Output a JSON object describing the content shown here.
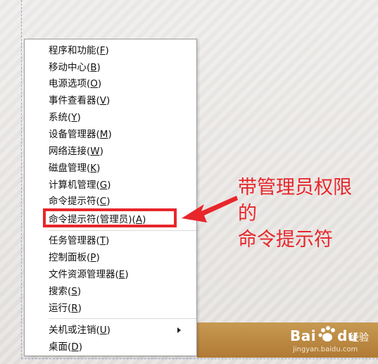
{
  "context_menu": {
    "items": [
      {
        "prefix": "程序和功能(",
        "key": "F",
        "suffix": ")"
      },
      {
        "prefix": "移动中心(",
        "key": "B",
        "suffix": ")"
      },
      {
        "prefix": "电源选项(",
        "key": "O",
        "suffix": ")"
      },
      {
        "prefix": "事件查看器(",
        "key": "V",
        "suffix": ")"
      },
      {
        "prefix": "系统(",
        "key": "Y",
        "suffix": ")"
      },
      {
        "prefix": "设备管理器(",
        "key": "M",
        "suffix": ")"
      },
      {
        "prefix": "网络连接(",
        "key": "W",
        "suffix": ")"
      },
      {
        "prefix": "磁盘管理(",
        "key": "K",
        "suffix": ")"
      },
      {
        "prefix": "计算机管理(",
        "key": "G",
        "suffix": ")"
      },
      {
        "prefix": "命令提示符(",
        "key": "C",
        "suffix": ")"
      },
      {
        "prefix": "命令提示符(管理员)(",
        "key": "A",
        "suffix": ")"
      },
      {
        "prefix": "任务管理器(",
        "key": "T",
        "suffix": ")"
      },
      {
        "prefix": "控制面板(",
        "key": "P",
        "suffix": ")"
      },
      {
        "prefix": "文件资源管理器(",
        "key": "E",
        "suffix": ")"
      },
      {
        "prefix": "搜索(",
        "key": "S",
        "suffix": ")"
      },
      {
        "prefix": "运行(",
        "key": "R",
        "suffix": ")"
      },
      {
        "prefix": "关机或注销(",
        "key": "U",
        "suffix": ")"
      },
      {
        "prefix": "桌面(",
        "key": "D",
        "suffix": ")"
      }
    ]
  },
  "annotation": {
    "line1": "带管理员权限",
    "line2": "的",
    "line3": "命令提示符",
    "color": "#e8262b"
  },
  "watermark": {
    "brand": "Bai",
    "brand_suffix": "du",
    "product": "经验",
    "url": "jingyan.baidu.com"
  }
}
